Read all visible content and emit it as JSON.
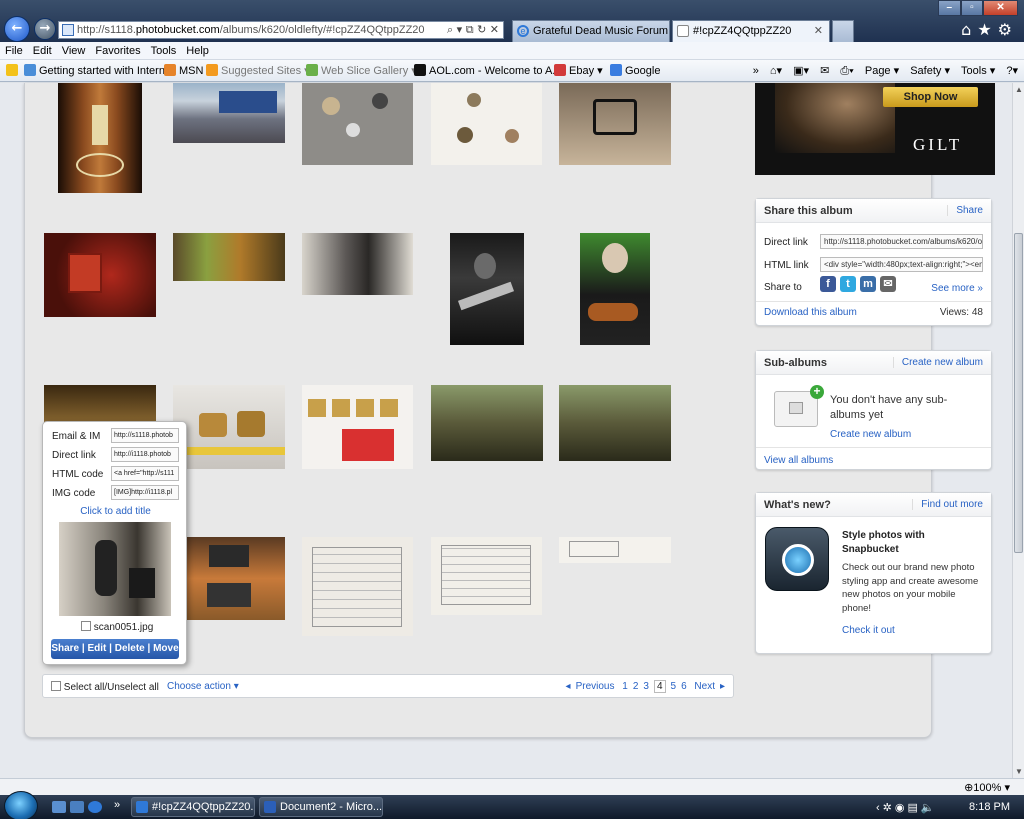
{
  "browser": {
    "address_prefix": "http://s1118.",
    "address_domain": "photobucket.com",
    "address_path": "/albums/k620/oldlefty/#!cpZZ4QQtppZZ20",
    "tabs": [
      {
        "title": "Grateful Dead Music Forum"
      },
      {
        "title": "#!cpZZ4QQtppZZ20"
      }
    ],
    "menu": [
      "File",
      "Edit",
      "View",
      "Favorites",
      "Tools",
      "Help"
    ],
    "favorites": [
      {
        "label": "Getting started with Intern..."
      },
      {
        "label": "MSN"
      },
      {
        "label": "Suggested Sites ▾"
      },
      {
        "label": "Web Slice Gallery ▾"
      },
      {
        "label": "AOL.com - Welcome to A..."
      },
      {
        "label": "Ebay ▾"
      },
      {
        "label": "Google"
      }
    ],
    "commands": [
      "Page ▾",
      "Safety ▾",
      "Tools ▾"
    ],
    "zoom": "100%"
  },
  "ad": {
    "button": "Shop Now",
    "brand": "GILT"
  },
  "share_album": {
    "title": "Share this album",
    "share_link": "Share",
    "direct_link_label": "Direct link",
    "direct_link_value": "http://s1118.photobucket.com/albums/k620/o",
    "html_link_label": "HTML link",
    "html_link_value": "<div style=\"width:480px;text-align:right;\"><em",
    "share_to_label": "Share to",
    "see_more": "See more »",
    "download": "Download this album",
    "views": "Views: 48"
  },
  "sub_albums": {
    "title": "Sub-albums",
    "create_link": "Create new album",
    "empty_text": "You don't have any sub-albums yet",
    "create_album": "Create new album",
    "view_all": "View all albums"
  },
  "whats_new": {
    "title": "What's new?",
    "find_out": "Find out more",
    "headline": "Style photos with Snapbucket",
    "body": "Check out our brand new photo styling app and create awesome new photos on your mobile phone!",
    "cta": "Check it out"
  },
  "popup": {
    "email_label": "Email & IM",
    "email_value": "http://s1118.photob",
    "direct_label": "Direct link",
    "direct_value": "http://i1118.photob",
    "html_label": "HTML code",
    "html_value": "<a href=\"http://s111",
    "img_label": "IMG code",
    "img_value": "[IMG]http://i1118.pl",
    "add_title": "Click to add title",
    "filename": "scan0051.jpg",
    "actions": "Share | Edit | Delete | Move"
  },
  "bottom": {
    "select_all": "Select all/Unselect all",
    "choose_action": "Choose action ▾",
    "previous": "Previous",
    "pages": [
      "1",
      "2",
      "3",
      "4",
      "5",
      "6"
    ],
    "current_page": "4",
    "next": "Next"
  },
  "taskbar": {
    "items": [
      {
        "label": "#!cpZZ4QQtppZZ20..."
      },
      {
        "label": "Document2 - Micro..."
      }
    ],
    "clock": "8:18 PM"
  }
}
